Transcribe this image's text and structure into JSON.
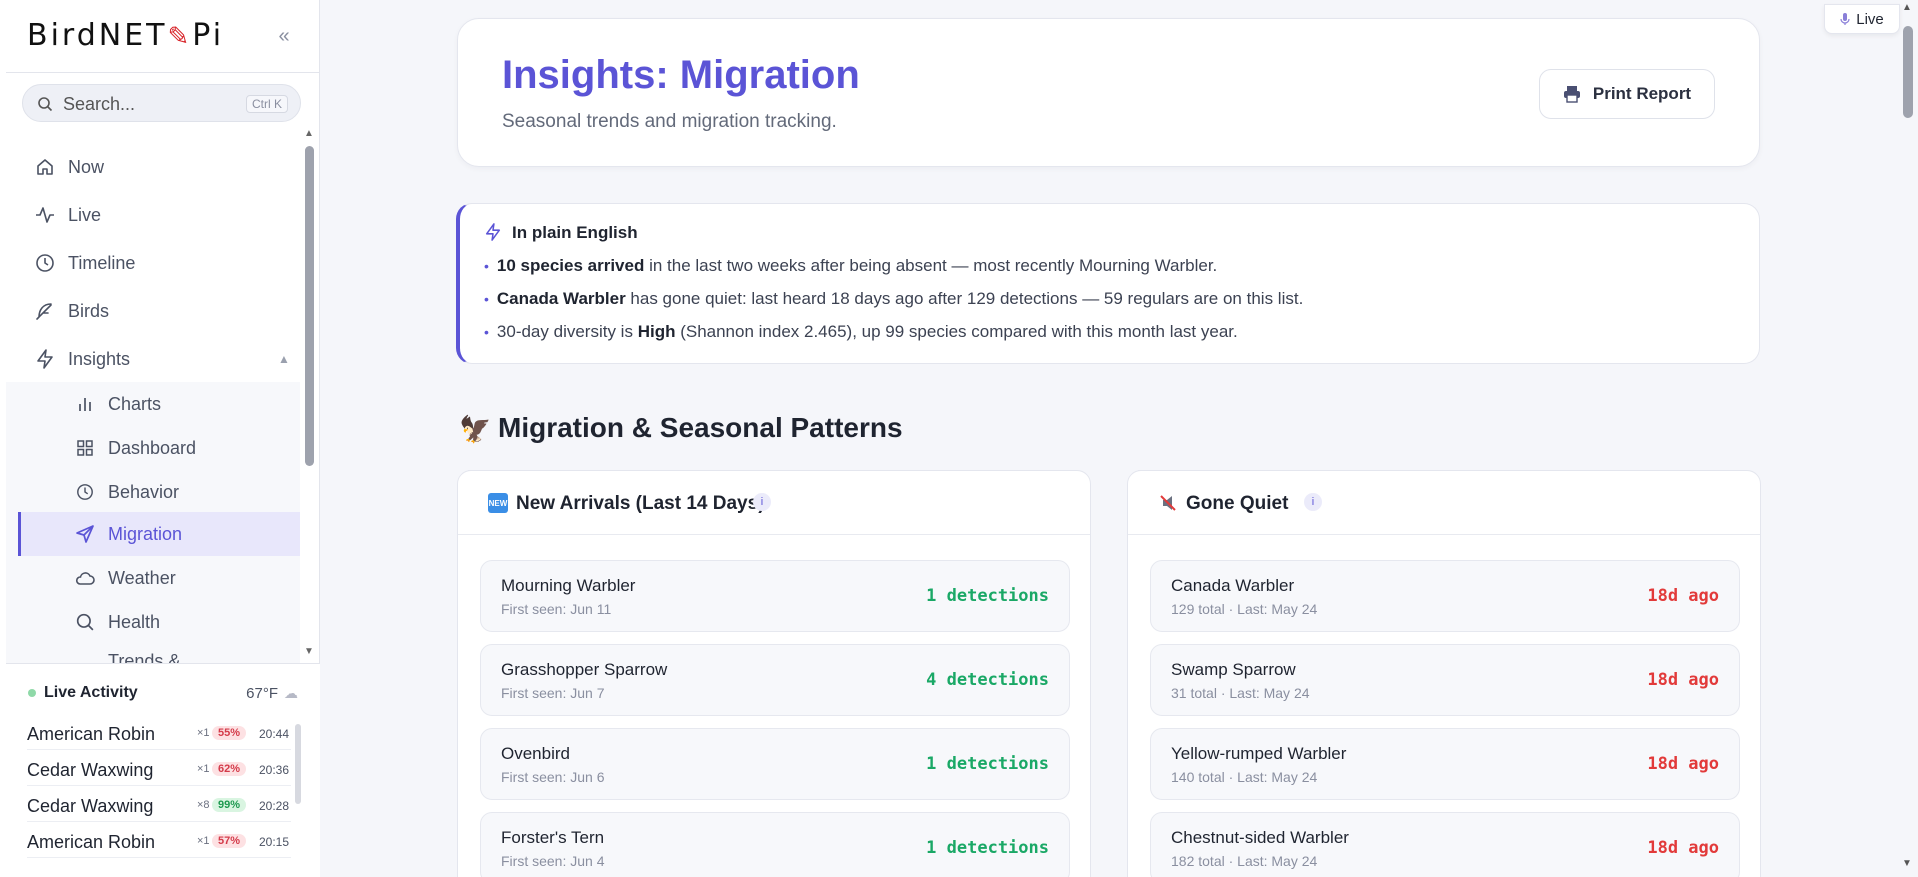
{
  "sidebar": {
    "brand_left": "BirdNET",
    "brand_right": "Pi",
    "collapse_label": "«",
    "search": {
      "placeholder": "Search...",
      "shortcut": "Ctrl K"
    },
    "nav": [
      {
        "label": "Now",
        "icon": "home-icon"
      },
      {
        "label": "Live",
        "icon": "pulse-icon"
      },
      {
        "label": "Timeline",
        "icon": "clock-icon"
      },
      {
        "label": "Birds",
        "icon": "feather-icon"
      },
      {
        "label": "Insights",
        "icon": "bolt-icon"
      }
    ],
    "insights_sub": [
      {
        "label": "Charts",
        "icon": "bar-chart-icon"
      },
      {
        "label": "Dashboard",
        "icon": "grid-icon"
      },
      {
        "label": "Behavior",
        "icon": "clock-icon"
      },
      {
        "label": "Migration",
        "icon": "send-icon",
        "active": true
      },
      {
        "label": "Weather",
        "icon": "cloud-icon"
      },
      {
        "label": "Health",
        "icon": "search-icon"
      },
      {
        "label": "Trends &",
        "icon": "trend-icon"
      }
    ],
    "activity": {
      "title": "Live Activity",
      "temperature": "67°F",
      "rows": [
        {
          "name": "American Robin",
          "count": "×1",
          "confidence": "55%",
          "time": "20:44",
          "level": "low"
        },
        {
          "name": "Cedar Waxwing",
          "count": "×1",
          "confidence": "62%",
          "time": "20:36",
          "level": "low"
        },
        {
          "name": "Cedar Waxwing",
          "count": "×8",
          "confidence": "99%",
          "time": "20:28",
          "level": "high"
        },
        {
          "name": "American Robin",
          "count": "×1",
          "confidence": "57%",
          "time": "20:15",
          "level": "low"
        }
      ]
    }
  },
  "live_chip": {
    "label": "Live"
  },
  "header": {
    "title": "Insights: Migration",
    "subtitle": "Seasonal trends and migration tracking.",
    "print_label": "Print Report"
  },
  "summary": {
    "title": "In plain English",
    "b1_bold": "10 species arrived",
    "b1_rest": " in the last two weeks after being absent — most recently Mourning Warbler.",
    "b2_bold": "Canada Warbler",
    "b2_rest": " has gone quiet: last heard 18 days ago after 129 detections — 59 regulars are on this list.",
    "b3_pre": "30-day diversity is ",
    "b3_bold": "High",
    "b3_rest": " (Shannon index 2.465), up 99 species compared with this month last year."
  },
  "section": {
    "title": "Migration & Seasonal Patterns"
  },
  "arrivals": {
    "title": "New Arrivals (Last 14 Days)",
    "badge": "NEW",
    "info": "i",
    "items": [
      {
        "name": "Mourning Warbler",
        "meta": "First seen: Jun 11",
        "value": "1 detections"
      },
      {
        "name": "Grasshopper Sparrow",
        "meta": "First seen: Jun 7",
        "value": "4 detections"
      },
      {
        "name": "Ovenbird",
        "meta": "First seen: Jun 6",
        "value": "1 detections"
      },
      {
        "name": "Forster's Tern",
        "meta": "First seen: Jun 4",
        "value": "1 detections"
      }
    ]
  },
  "quiet": {
    "title": "Gone Quiet",
    "info": "i",
    "items": [
      {
        "name": "Canada Warbler",
        "meta": "129 total · Last: May 24",
        "value": "18d ago"
      },
      {
        "name": "Swamp Sparrow",
        "meta": "31 total · Last: May 24",
        "value": "18d ago"
      },
      {
        "name": "Yellow-rumped Warbler",
        "meta": "140 total · Last: May 24",
        "value": "18d ago"
      },
      {
        "name": "Chestnut-sided Warbler",
        "meta": "182 total · Last: May 24",
        "value": "18d ago"
      }
    ]
  },
  "colors": {
    "accent": "#5b54d6",
    "green": "#1aa866",
    "red": "#e23a3a"
  }
}
